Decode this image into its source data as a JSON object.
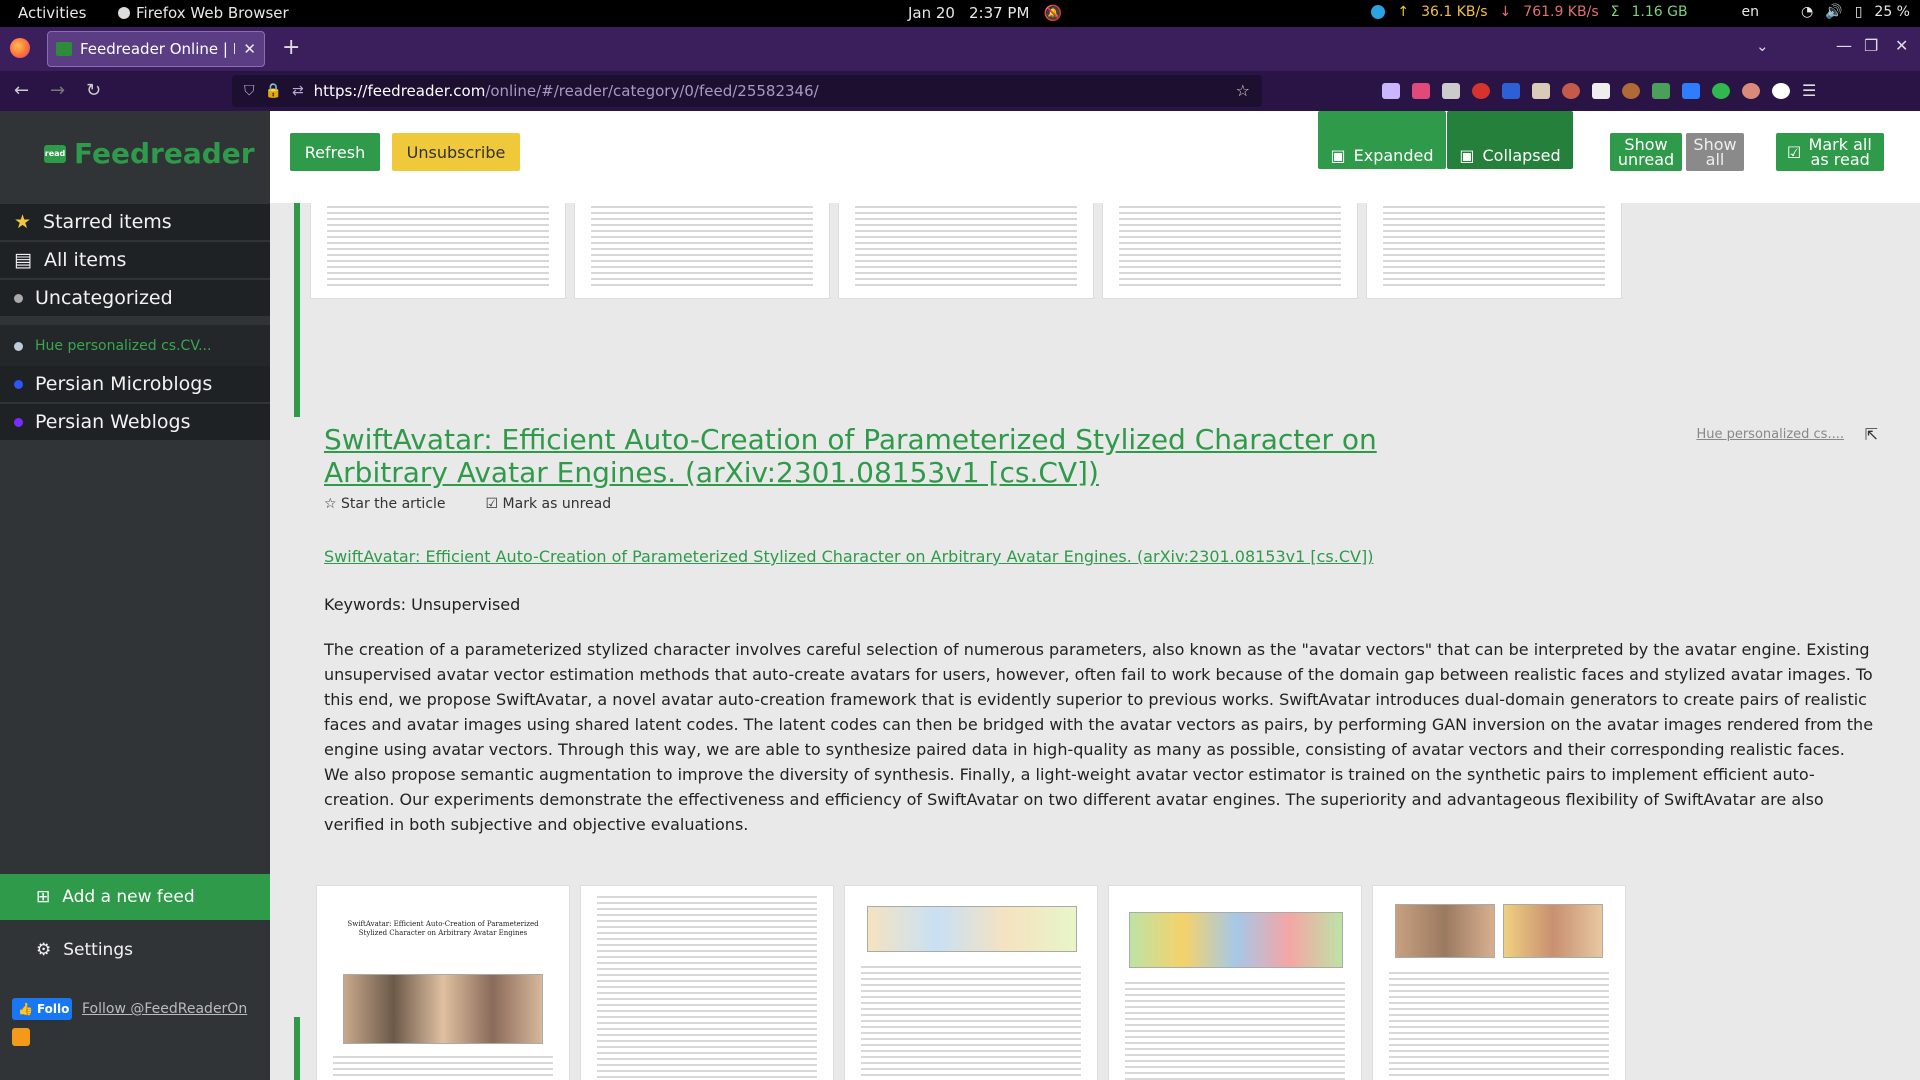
{
  "gnome": {
    "activities": "Activities",
    "app_name": "Firefox Web Browser",
    "date": "Jan 20",
    "time": "2:37 PM",
    "net_up": "36.1 KB/s",
    "net_down": "761.9 KB/s",
    "net_total": "1.16 GB",
    "lang": "en",
    "battery": "25 %",
    "icons": [
      "telegram-icon",
      "upload-arrow-icon",
      "download-arrow-icon",
      "sigma-icon",
      "wifi-icon",
      "volume-icon",
      "battery-icon",
      "bell-off-icon"
    ]
  },
  "browser": {
    "tab_title": "Feedreader Online | Free",
    "url_host": "https://feedreader.com",
    "url_path": "/online/#/reader/category/0/feed/25582346/",
    "colors": {
      "tabstrip": "#3a1f5c",
      "navbar": "#2a1446"
    }
  },
  "sidebar": {
    "logo_badge": "read",
    "logo_text": "Feedreader",
    "items": [
      {
        "label": "Starred items",
        "icon": "star-icon"
      },
      {
        "label": "All items",
        "icon": "list-icon"
      },
      {
        "label": "Uncategorized",
        "icon": "dot-icon"
      },
      {
        "label": "Hue personalized cs.CV...",
        "icon": "globe-icon"
      },
      {
        "label": "Persian Microblogs",
        "icon": "blue-dot-icon"
      },
      {
        "label": "Persian Weblogs",
        "icon": "purple-dot-icon"
      }
    ],
    "add_feed": "Add a new feed",
    "settings": "Settings",
    "fb_button": "Follo",
    "follow_link": "Follow @FeedReaderOn"
  },
  "toolbar": {
    "refresh": "Refresh",
    "unsubscribe": "Unsubscribe",
    "expanded": "Expanded",
    "collapsed": "Collapsed",
    "show_unread": "Show unread",
    "show_all": "Show all",
    "mark_all": "Mark all as read",
    "accent": "#2e9a4a"
  },
  "article": {
    "title": "SwiftAvatar: Efficient Auto-Creation of Parameterized Stylized Character on Arbitrary Avatar Engines. (arXiv:2301.08153v1 [cs.CV])",
    "feed_name": "Hue personalized cs....",
    "star": "Star the article",
    "mark_unread": "Mark as unread",
    "link": "SwiftAvatar: Efficient Auto-Creation of Parameterized Stylized Character on Arbitrary Avatar Engines. (arXiv:2301.08153v1 [cs.CV])",
    "keywords": "Keywords: Unsupervised",
    "abstract": "The creation of a parameterized stylized character involves careful selection of numerous parameters, also known as the \"avatar vectors\" that can be interpreted by the avatar engine. Existing unsupervised avatar vector estimation methods that auto-create avatars for users, however, often fail to work because of the domain gap between realistic faces and stylized avatar images. To this end, we propose SwiftAvatar, a novel avatar auto-creation framework that is evidently superior to previous works. SwiftAvatar introduces dual-domain generators to create pairs of realistic faces and avatar images using shared latent codes. The latent codes can then be bridged with the avatar vectors as pairs, by performing GAN inversion on the avatar images rendered from the engine using avatar vectors. Through this way, we are able to synthesize paired data in high-quality as many as possible, consisting of avatar vectors and their corresponding realistic faces. We also propose semantic augmentation to improve the diversity of synthesis. Finally, a light-weight avatar vector estimator is trained on the synthetic pairs to implement efficient auto-creation. Our experiments demonstrate the effectiveness and efficiency of SwiftAvatar on two different avatar engines. The superiority and advantageous flexibility of SwiftAvatar are also verified in both subjective and objective evaluations."
  },
  "paper_page_title": "SwiftAvatar: Efficient Auto-Creation of Parameterized Stylized Character on Arbitrary Avatar Engines"
}
